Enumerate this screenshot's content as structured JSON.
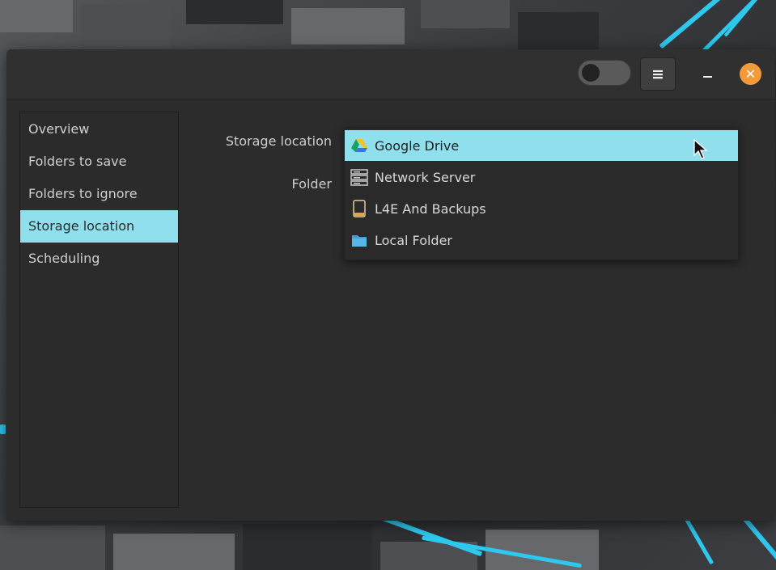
{
  "window": {
    "dark_mode_toggle": "off",
    "menu_icon": "hamburger-icon",
    "minimize_icon": "minimize-icon",
    "close_icon": "close-icon",
    "close_symbol": "✕",
    "menu_symbol": "≡"
  },
  "sidebar": {
    "items": [
      {
        "label": "Overview"
      },
      {
        "label": "Folders to save"
      },
      {
        "label": "Folders to ignore"
      },
      {
        "label": "Storage location",
        "active": true
      },
      {
        "label": "Scheduling"
      }
    ]
  },
  "form": {
    "storage_location_label": "Storage location",
    "folder_label": "Folder"
  },
  "storage_dropdown": {
    "options": [
      {
        "label": "Google Drive",
        "icon": "google-drive-icon",
        "selected": true
      },
      {
        "label": "Network Server",
        "icon": "server-icon"
      },
      {
        "label": "L4E And Backups",
        "icon": "drive-icon"
      },
      {
        "label": "Local Folder",
        "icon": "folder-icon"
      }
    ]
  },
  "colors": {
    "accent": "#8fdfed",
    "close": "#f39a3a",
    "window_bg": "#2c2c2c"
  }
}
